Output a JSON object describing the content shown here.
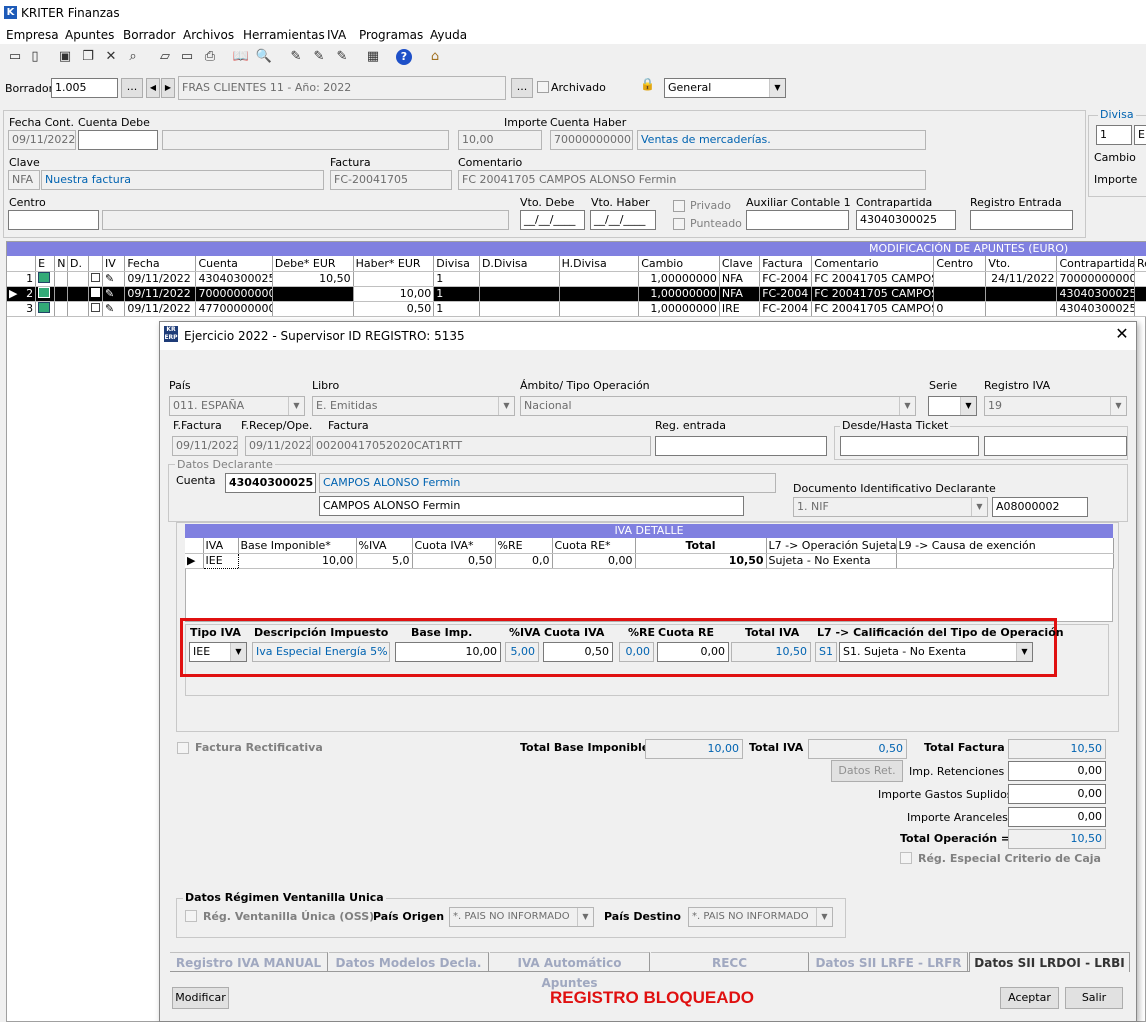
{
  "app": {
    "title": "KRITER Finanzas"
  },
  "menu": [
    "Empresa",
    "Apuntes",
    "Borrador",
    "Archivos",
    "Herramientas",
    "IVA",
    "Programas",
    "Ayuda"
  ],
  "toolbar": {
    "icons": [
      "new-icon",
      "open-icon",
      "save-icon",
      "copy-icon",
      "delete-icon",
      "find-icon",
      "folder-icon",
      "folder-open-icon",
      "print-icon",
      "book-icon",
      "search-icon",
      "edit1-icon",
      "edit2-icon",
      "edit3-icon",
      "calc-icon",
      "help-icon",
      "exit-icon"
    ]
  },
  "borrador": {
    "label": "Borrador",
    "value": "1.005",
    "ellipsis": "...",
    "desc": "FRAS CLIENTES 11 - Año: 2022",
    "archivado": "Archivado",
    "combo": "General"
  },
  "header": {
    "fecha_cont_label": "Fecha Cont.",
    "fecha_cont": "09/11/2022",
    "cuenta_debe_label": "Cuenta Debe",
    "cuenta_debe": "",
    "cuenta_debe_desc": "",
    "importe_label": "Importe",
    "importe": "10,00",
    "cuenta_haber_label": "Cuenta Haber",
    "cuenta_haber": "70000000000",
    "cuenta_haber_desc": "Ventas de mercaderías.",
    "clave_label": "Clave",
    "clave": "NFA",
    "clave_desc": "Nuestra factura",
    "factura_label": "Factura",
    "factura": "FC-20041705",
    "comentario_label": "Comentario",
    "comentario": "FC 20041705 CAMPOS ALONSO  Fermin",
    "centro_label": "Centro",
    "centro": "",
    "centro_desc": "",
    "vto_debe_label": "Vto. Debe",
    "vto_debe": "__/__/____",
    "vto_haber_label": "Vto. Haber",
    "vto_haber": "__/__/____",
    "privado": "Privado",
    "punteado": "Punteado",
    "aux_label": "Auxiliar Contable 1",
    "aux": "",
    "contrapartida_label": "Contrapartida",
    "contrapartida": "43040300025",
    "registro_label": "Registro  Entrada",
    "registro": ""
  },
  "divisa_box": {
    "title": "Divisa",
    "divisa": "1",
    "divisa2": "E",
    "cambio": "Cambio",
    "importe": "Importe"
  },
  "apuntes": {
    "title": "MODIFICACIÓN DE APUNTES (EURO)",
    "columns": [
      "",
      "E",
      "N",
      "D.",
      "",
      "IV",
      "Fecha",
      "Cuenta",
      "Debe* EUR",
      "Haber* EUR",
      "Divisa",
      "D.Divisa",
      "H.Divisa",
      "Cambio",
      "Clave",
      "Factura",
      "Comentario",
      "Centro",
      "Vto.",
      "Contrapartida",
      "Reg."
    ],
    "rows": [
      [
        "1",
        "",
        "",
        "",
        "",
        "",
        "09/11/2022",
        "43040300025",
        "10,50",
        "",
        "1",
        "",
        "",
        "1,00000000",
        "NFA",
        "FC-2004",
        "FC 20041705 CAMPOS",
        "",
        "24/11/2022",
        "70000000000",
        ""
      ],
      [
        "2",
        "",
        "",
        "",
        "",
        "",
        "09/11/2022",
        "70000000000",
        "",
        "10,00",
        "1",
        "",
        "",
        "1,00000000",
        "NFA",
        "FC-2004",
        "FC 20041705 CAMPOS",
        "",
        "",
        "43040300025",
        ""
      ],
      [
        "3",
        "",
        "",
        "",
        "",
        "",
        "09/11/2022",
        "47700000000",
        "",
        "0,50",
        "1",
        "",
        "",
        "1,00000000",
        "IRE",
        "FC-2004",
        "FC 20041705 CAMPOS",
        "0",
        "",
        "43040300025",
        ""
      ]
    ]
  },
  "dialog": {
    "title": "Ejercicio 2022 - Supervisor ID REGISTRO: 5135",
    "pais_label": "País",
    "pais": "011.  ESPAÑA",
    "libro_label": "Libro",
    "libro": "E. Emitidas",
    "ambito_label": "Ámbito/ Tipo Operación",
    "ambito": "Nacional",
    "serie_label": "Serie",
    "serie": "",
    "registro_iva_label": "Registro IVA",
    "registro_iva": "19",
    "ffactura_label": "F.Factura",
    "ffactura": "09/11/2022",
    "frecep_label": "F.Recep/Ope.",
    "frecep": "09/11/2022",
    "factura_label": "Factura",
    "factura": "00200417052020CAT1RTT",
    "reg_entrada_label": "Reg. entrada",
    "reg_entrada": "",
    "desde_hasta_label": "Desde/Hasta Ticket",
    "datos_declarante": "Datos Declarante",
    "cuenta_label": "Cuenta",
    "cuenta": "43040300025",
    "cuenta_desc": "CAMPOS ALONSO Fermin",
    "nombre": "CAMPOS ALONSO Fermin",
    "doc_label": "Documento Identificativo Declarante",
    "doc_tipo": "1. NIF",
    "doc_num": "A08000002",
    "iva_detalle": {
      "title": "IVA DETALLE",
      "columns": [
        "",
        "IVA",
        "Base Imponible*",
        "%IVA",
        "Cuota IVA*",
        "%RE",
        "Cuota RE*",
        "Total",
        "L7 -> Operación Sujeta",
        "L9 -> Causa de exención"
      ],
      "row": [
        "",
        "IEE",
        "10,00",
        "5,0",
        "0,50",
        "0,0",
        "0,00",
        "10,50",
        "Sujeta - No Exenta",
        ""
      ]
    },
    "edit": {
      "tipo_iva_label": "Tipo IVA",
      "desc_label": "Descripción Impuesto",
      "base_label": "Base Imp.",
      "piva_label": "%IVA",
      "cuota_label": "Cuota IVA",
      "pre_label": "%RE",
      "cuota_re_label": "Cuota RE",
      "total_label": "Total IVA",
      "l7_label": "L7 -> Calificación del Tipo de Operación",
      "tipo_iva": "IEE",
      "desc": "Iva Especial Energía 5%",
      "base": "10,00",
      "piva": "5,00",
      "cuota": "0,50",
      "pre": "0,00",
      "cuota_re": "0,00",
      "total": "10,50",
      "l7_code": "S1",
      "l7": "S1. Sujeta - No Exenta"
    },
    "factura_rect": "Factura Rectificativa",
    "total_base_label": "Total Base Imponible",
    "total_base": "10,00",
    "total_iva_label": "Total IVA",
    "total_iva": "0,50",
    "total_factura_label": "Total Factura",
    "total_factura": "10,50",
    "datos_ret": "Datos Ret.",
    "imp_ret_label": "Imp. Retenciones +",
    "imp_ret": "0,00",
    "gastos_label": "Importe Gastos Suplidos +",
    "gastos": "0,00",
    "aranceles_label": "Importe Aranceles +",
    "aranceles": "0,00",
    "total_op_label": "Total Operación =",
    "total_op": "10,50",
    "reg_especial": "Rég. Especial Criterio de Caja",
    "ventanilla_title": "Datos Régimen Ventanilla Unica",
    "ventanilla_chk": "Rég. Ventanilla Única (OSS)",
    "pais_origen_label": "País Origen",
    "pais_origen": "*. PAIS NO INFORMADO",
    "pais_destino_label": "País Destino",
    "pais_destino": "*. PAIS NO INFORMADO",
    "tabs": [
      "Registro IVA MANUAL",
      "Datos Modelos Decla.",
      "IVA Automático Apuntes",
      "RECC",
      "Datos SII  LRFE - LRFR",
      "Datos SII LRDOI - LRBI"
    ],
    "modificar": "Modificar",
    "bloqueado": "REGISTRO BLOQUEADO",
    "aceptar": "Aceptar",
    "salir": "Salir"
  },
  "colors": {
    "grid_header": "#8080e0",
    "selected_row": "#000000",
    "accent_red": "#e01010",
    "blue_text": "#0063b1"
  }
}
